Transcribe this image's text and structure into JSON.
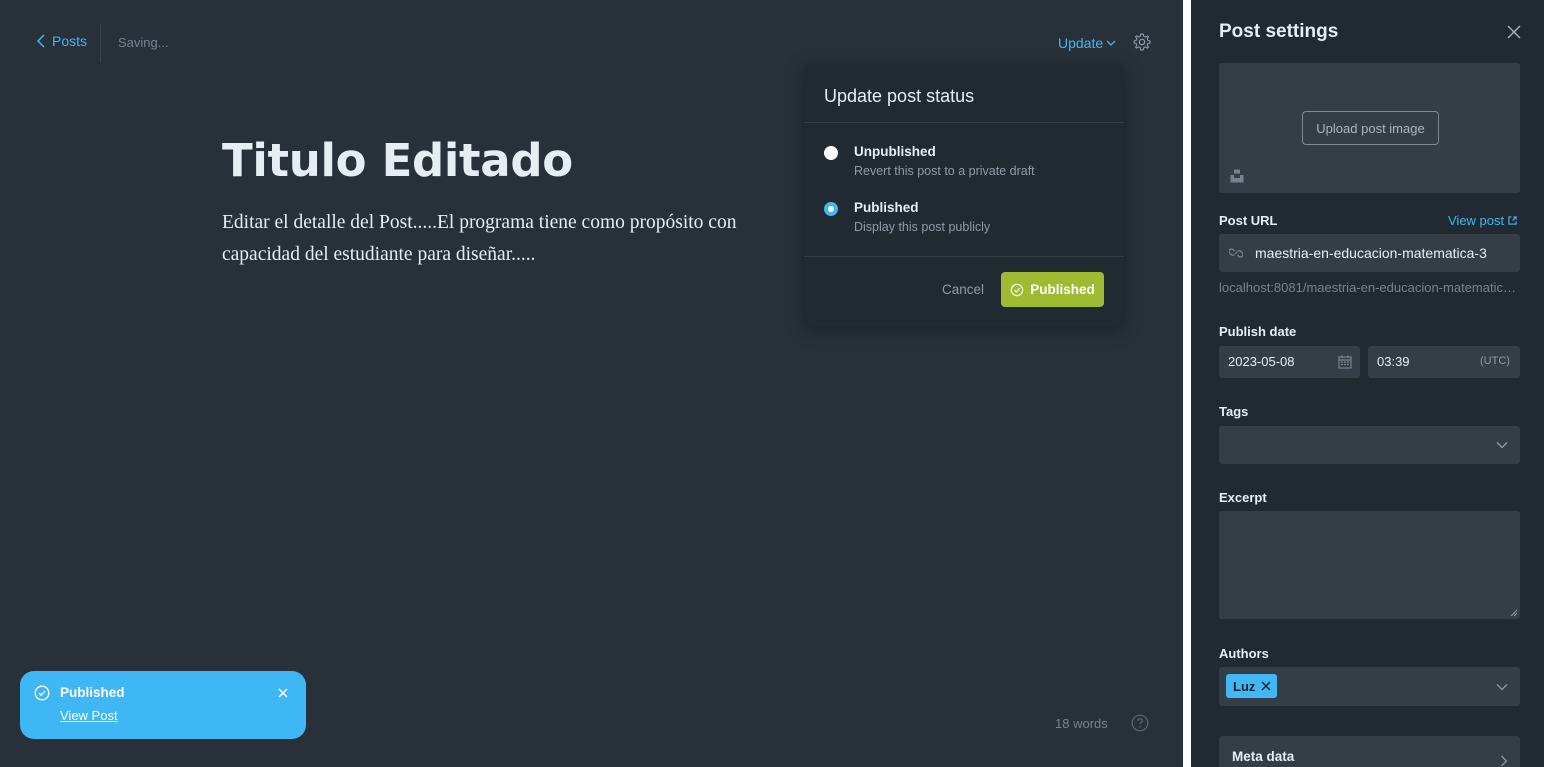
{
  "topbar": {
    "back_label": "Posts",
    "status": "Saving...",
    "update_label": "Update"
  },
  "post": {
    "title": "Titulo Editado",
    "body_line1": "Editar el detalle del Post.....El programa tiene como propósito con",
    "body_line2": "capacidad del estudiante para diseñar....."
  },
  "popover": {
    "title": "Update post status",
    "options": [
      {
        "label": "Unpublished",
        "description": "Revert this post to a private draft",
        "selected": false
      },
      {
        "label": "Published",
        "description": "Display this post publicly",
        "selected": true
      }
    ],
    "cancel_label": "Cancel",
    "confirm_label": "Published"
  },
  "toast": {
    "title": "Published",
    "link": "View Post"
  },
  "footer": {
    "word_count": "18 words"
  },
  "sidebar": {
    "title": "Post settings",
    "upload_label": "Upload post image",
    "post_url_label": "Post URL",
    "view_post_label": "View post",
    "post_url_value": "maestria-en-educacion-matematica-3",
    "url_preview": "localhost:8081/maestria-en-educacion-matematica-3/",
    "publish_date_label": "Publish date",
    "date_value": "2023-05-08",
    "time_value": "03:39",
    "timezone": "(UTC)",
    "tags_label": "Tags",
    "excerpt_label": "Excerpt",
    "authors_label": "Authors",
    "author_tag": "Luz",
    "meta_data_label": "Meta data"
  },
  "colors": {
    "accent": "#41b7f5",
    "publish_green": "#9fbb32",
    "editor_bg": "#28313a",
    "sidebar_bg": "#212a31"
  },
  "icons": [
    "chevron-left-icon",
    "chevron-down-icon",
    "gear-icon",
    "check-circle-icon",
    "close-icon",
    "help-icon",
    "link-icon",
    "external-link-icon",
    "calendar-icon",
    "unsplash-icon",
    "chevron-right-icon"
  ]
}
